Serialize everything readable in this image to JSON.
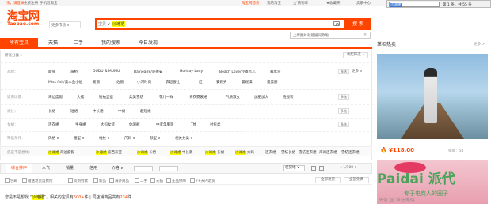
{
  "topbar": {
    "greeting": "亲，请登录",
    "register": "免费注册",
    "mobile": "手机逛淘宝",
    "home": "淘宝网首页",
    "my_taobao": "我的淘宝",
    "cart": "购物车",
    "favorites": "收藏夹",
    "seller": "卖家中心"
  },
  "find": {
    "query": "沙滩裙",
    "count": "第 1 条，共 55 条"
  },
  "logo": {
    "cn": "淘宝网",
    "en": "Taobao.com"
  },
  "site_select": "更多市场",
  "search": {
    "type": "宝贝",
    "query": "沙滩裙",
    "button": "搜 索",
    "tooltip": "上传图片就能搜同款啦"
  },
  "tabs": [
    "所有宝贝",
    "天猫",
    "二手",
    "我的搜索",
    "今日发现"
  ],
  "crumb": "所有分类 >",
  "collapse_label": "收起筛选 ∧",
  "filters": [
    {
      "label": "品牌：",
      "values": [
        "斯琴",
        "海桥",
        "DUDU & MUMU",
        "Balneaire/范德安",
        "Holiday Lady",
        "Beach Love/沙滩恋儿",
        "鑫水鸟",
        "Miss fish/美人鱼小姐",
        "爱丽",
        "佐丽",
        "小河时尚",
        "衣超服社",
        "红",
        "安则男",
        "曼妮琪",
        "曼美丽"
      ],
      "multi": "多选",
      "more": "更多"
    },
    {
      "label": "适用场景：",
      "values": [
        "海边度假",
        "大摆",
        "短袖显瘦",
        "柔美雪纺",
        "花儿一样",
        "青衣霓裳裙",
        "气质淑女",
        "加肥加大",
        "透视装"
      ],
      "multi": "多选"
    },
    {
      "label": "裙长：",
      "values": [
        "长裙",
        "短裙",
        "中长裙",
        "中裙",
        "超短裙"
      ],
      "multi": "多选"
    },
    {
      "label": "女裙：",
      "values": [
        "连衣裙",
        "半身裙",
        "大码女装",
        "休闲裤",
        "中老年服装",
        "T恤",
        "衬衫类"
      ],
      "multi": "多选"
    },
    {
      "label": "筛选条件：",
      "values": [
        "风格 ∨",
        "腰型 ∨",
        "袖长 ∨",
        "尺码 ∨",
        "领型 ∨",
        "相关分类 ∨"
      ]
    }
  ],
  "related": {
    "label": "您是不是想找：",
    "items": [
      "沙滩裙 海边度假",
      "沙滩裙 波西米亚",
      "沙滩裙 长裙",
      "沙滩裙 中长款",
      "沙滩裙 长裙",
      "沙滩裙 大码",
      "连衣裙",
      "雪纺长裙",
      "雪纺连衣裙",
      "海滩连衣裙",
      "雪纺连衣裙"
    ]
  },
  "sort": {
    "items": [
      "综合排序",
      "人气",
      "销量",
      "信用",
      "价格"
    ],
    "ship_from": "发货地",
    "page": "1/100"
  },
  "checks": [
    "包邮",
    "赠送退货运费险",
    "货到付款",
    "新品",
    "海外商品",
    "二手",
    "天猫",
    "正品保障",
    "7+天内退货"
  ],
  "check_buttons": [
    "全部退货",
    "全部免费"
  ],
  "notice": {
    "prefix": "您是不是想找",
    "keyword": "沙滩裙",
    "mid": "，相关的宝贝有",
    "count1": "500+",
    "sep": "件  |  ",
    "mid2": "同店铺商品共有",
    "count2": "234",
    "suffix": "件"
  },
  "sidebar": {
    "title": "掌柜热卖",
    "more": "更多 >",
    "price": "¥118.00",
    "sold": "销量：58",
    "watermark": "Paidai",
    "watermark_cn": "派代",
    "watermark_sub": "专于电商人的圈子",
    "watermark_tag": "头条 @ 谁在等待"
  },
  "colors": {
    "accent": "#ff4400",
    "highlight": "#ffff00"
  }
}
